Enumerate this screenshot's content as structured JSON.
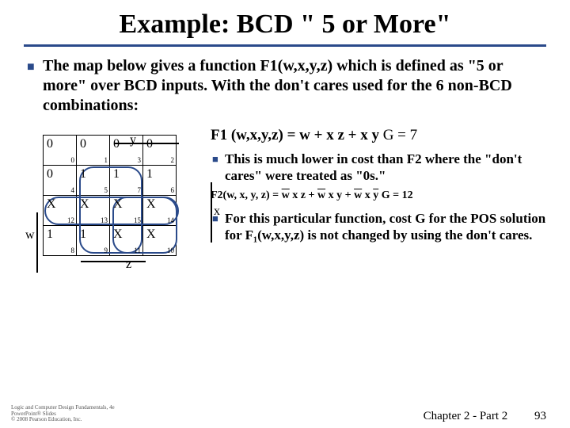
{
  "title": "Example: BCD \" 5 or More\"",
  "intro": "The map below gives a function F1(w,x,y,z) which is defined as \"5 or more\" over BCD inputs. With the don't cares used for the 6 non-BCD combinations:",
  "kmap": {
    "ylabel": "y",
    "xlabel": "x",
    "wlabel": "w",
    "zlabel": "z",
    "cells": [
      [
        {
          "v": "0",
          "i": "0"
        },
        {
          "v": "0",
          "i": "1"
        },
        {
          "v": "0",
          "i": "3"
        },
        {
          "v": "0",
          "i": "2"
        }
      ],
      [
        {
          "v": "0",
          "i": "4"
        },
        {
          "v": "1",
          "i": "5"
        },
        {
          "v": "1",
          "i": "7"
        },
        {
          "v": "1",
          "i": "6"
        }
      ],
      [
        {
          "v": "X",
          "i": "12"
        },
        {
          "v": "X",
          "i": "13"
        },
        {
          "v": "X",
          "i": "15"
        },
        {
          "v": "X",
          "i": "14"
        }
      ],
      [
        {
          "v": "1",
          "i": "8"
        },
        {
          "v": "1",
          "i": "9"
        },
        {
          "v": "X",
          "i": "11"
        },
        {
          "v": "X",
          "i": "10"
        }
      ]
    ]
  },
  "eq1_lhs": "F1 (w,x,y,z) = w + x z + x y",
  "eq1_g": "  G = 7",
  "bullets": [
    "This is much lower in cost than F2 where the \"don't cares\" were treated as \"0s.\"",
    "For this particular function, cost G for the POS solution for F₁(w,x,y,z) is not changed by using the don't cares."
  ],
  "eq2_parts": {
    "pre": "F2(w, x, y, z) = ",
    "t1a": "w",
    "t1b": "x",
    "t1c": "z",
    "plus": " + ",
    "t2a": "w",
    "t2b": "x",
    "t2c": "y",
    "t3a": "w",
    "t3b": "x",
    "t3c": "y",
    "g": " G = 12"
  },
  "footer": {
    "chapter": "Chapter 2 - Part 2",
    "page": "93"
  },
  "copyright": [
    "Logic and Computer Design Fundamentals, 4e",
    "PowerPoint® Slides",
    "© 2008 Pearson Education, Inc."
  ]
}
